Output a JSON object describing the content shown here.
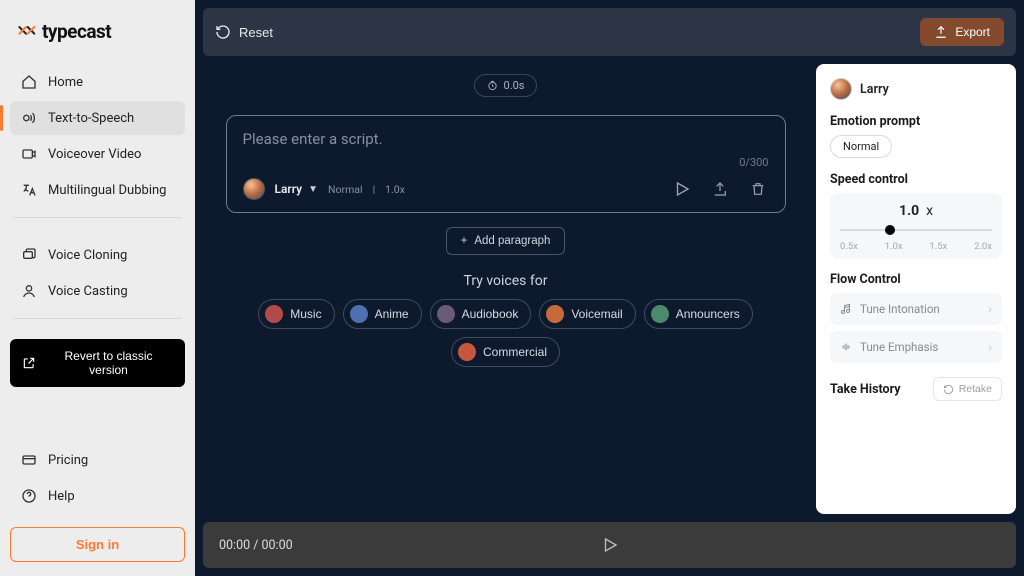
{
  "brand": "typecast",
  "sidebar": {
    "items": [
      {
        "label": "Home"
      },
      {
        "label": "Text-to-Speech"
      },
      {
        "label": "Voiceover Video"
      },
      {
        "label": "Multilingual Dubbing"
      }
    ],
    "secondary": [
      {
        "label": "Voice Cloning"
      },
      {
        "label": "Voice Casting"
      }
    ],
    "revert_label": "Revert to classic version",
    "bottom": [
      {
        "label": "Pricing"
      },
      {
        "label": "Help"
      }
    ],
    "signin_label": "Sign in"
  },
  "topbar": {
    "reset_label": "Reset",
    "export_label": "Export"
  },
  "center": {
    "time_pill": "0.0s",
    "script_placeholder": "Please enter a script.",
    "char_count": "0/300",
    "voice": {
      "name": "Larry",
      "emotion": "Normal",
      "speed": "1.0x"
    },
    "add_paragraph_label": "Add paragraph",
    "try_voices_label": "Try voices for",
    "chips": [
      "Music",
      "Anime",
      "Audiobook",
      "Voicemail",
      "Announcers",
      "Commercial"
    ],
    "chip_colors": [
      "#b44b4b",
      "#4f6fae",
      "#6a5a7a",
      "#c66a3a",
      "#4c8a6b",
      "#c6573f"
    ]
  },
  "panel": {
    "voice_name": "Larry",
    "emotion_label": "Emotion prompt",
    "emotion_value": "Normal",
    "speed_label": "Speed control",
    "speed_value": "1.0",
    "speed_suffix": "x",
    "speed_ticks": [
      "0.5x",
      "1.0x",
      "1.5x",
      "2.0x"
    ],
    "flow_label": "Flow Control",
    "flow_items": [
      "Tune Intonation",
      "Tune Emphasis"
    ],
    "take_label": "Take History",
    "retake_label": "Retake"
  },
  "player": {
    "time": "00:00 / 00:00"
  }
}
